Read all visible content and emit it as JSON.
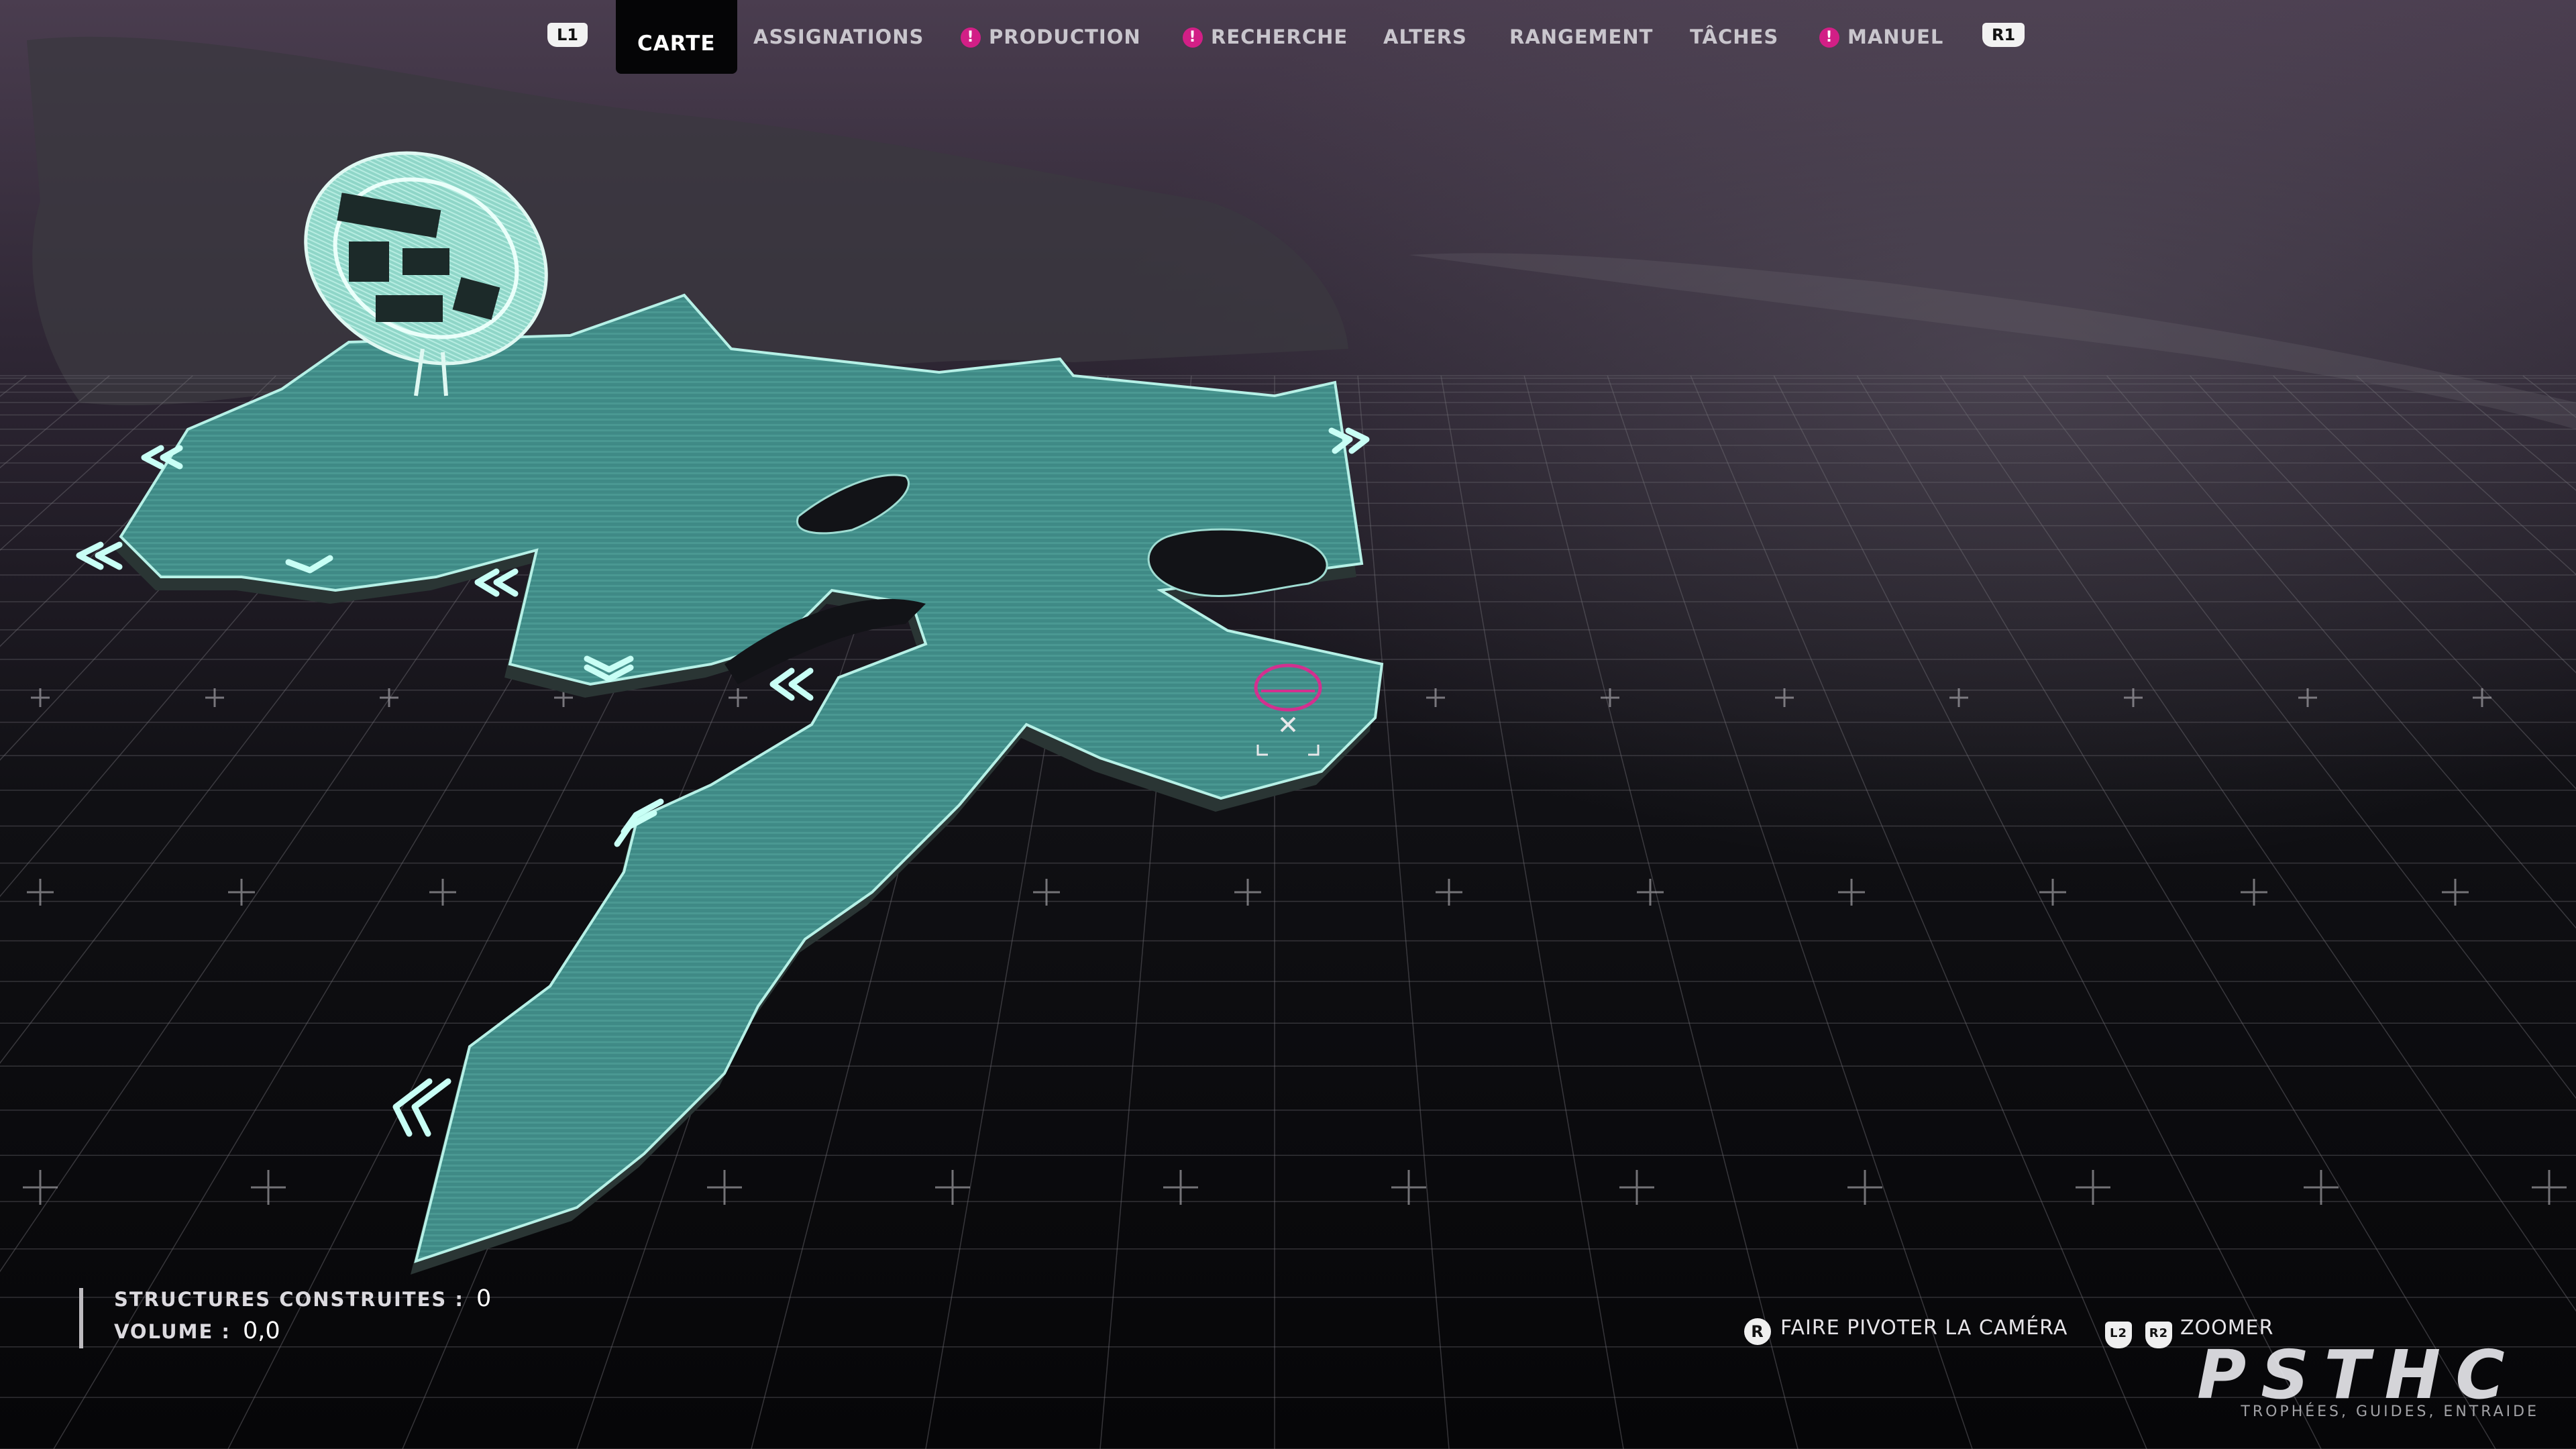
{
  "nav": {
    "left_bumper": "L1",
    "right_bumper": "R1",
    "tabs": [
      {
        "label": "CARTE",
        "active": true,
        "alert": false
      },
      {
        "label": "ASSIGNATIONS",
        "active": false,
        "alert": false
      },
      {
        "label": "PRODUCTION",
        "active": false,
        "alert": true
      },
      {
        "label": "RECHERCHE",
        "active": false,
        "alert": true
      },
      {
        "label": "ALTERS",
        "active": false,
        "alert": false
      },
      {
        "label": "RANGEMENT",
        "active": false,
        "alert": false
      },
      {
        "label": "TÂCHES",
        "active": false,
        "alert": false
      },
      {
        "label": "MANUEL",
        "active": false,
        "alert": true
      }
    ],
    "alert_glyph": "!"
  },
  "stats": {
    "structures_label": "STRUCTURES CONSTRUITES :",
    "structures_value": "0",
    "volume_label": "VOLUME :",
    "volume_value": "0,0"
  },
  "controls": {
    "rotate_button": "R",
    "rotate_label": "FAIRE PIVOTER LA CAMÉRA",
    "zoom_button_1": "L2",
    "zoom_button_2": "R2",
    "zoom_label": "ZOOMER"
  },
  "watermark": {
    "logo": "PSTHC",
    "tagline": "TROPHÉES, GUIDES, ENTRAIDE"
  },
  "colors": {
    "terrain": "#3e8783",
    "terrain_edge": "#b6f0e6",
    "marker": "#d2308f",
    "accent_alert": "#d21f86"
  },
  "icons": {
    "outpost": "outpost-dome-icon",
    "objective": "objective-marker-icon",
    "region_arrow": "region-chevron-icon"
  }
}
